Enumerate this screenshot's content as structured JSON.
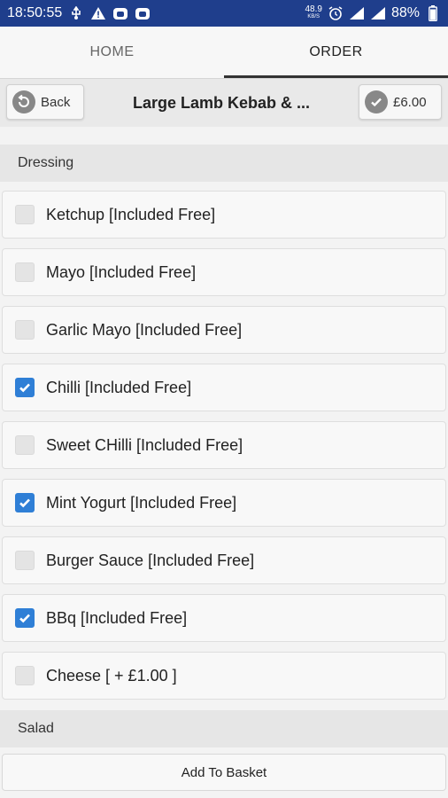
{
  "status_bar": {
    "time": "18:50:55",
    "net_speed_value": "48.9",
    "net_speed_unit": "KB/S",
    "battery": "88%",
    "left_icons": [
      "usb-icon",
      "warning-icon",
      "app-notification-icon",
      "app-notification-icon"
    ],
    "right_icons": [
      "alarm-icon",
      "signal-icon",
      "signal-icon",
      "battery-icon"
    ]
  },
  "tabs": [
    {
      "label": "HOME",
      "active": false
    },
    {
      "label": "ORDER",
      "active": true
    }
  ],
  "header": {
    "back_label": "Back",
    "title": "Large Lamb Kebab & ...",
    "price": "£6.00"
  },
  "sections": {
    "dressing": "Dressing",
    "salad": "Salad"
  },
  "options": [
    {
      "label": "Ketchup [Included Free]",
      "checked": false
    },
    {
      "label": "Mayo [Included Free]",
      "checked": false
    },
    {
      "label": "Garlic Mayo [Included Free]",
      "checked": false
    },
    {
      "label": "Chilli [Included Free]",
      "checked": true
    },
    {
      "label": "Sweet CHilli [Included Free]",
      "checked": false
    },
    {
      "label": "Mint Yogurt [Included Free]",
      "checked": true
    },
    {
      "label": "Burger Sauce [Included Free]",
      "checked": false
    },
    {
      "label": "BBq [Included Free]",
      "checked": true
    },
    {
      "label": "Cheese [ + £1.00 ]",
      "checked": false
    }
  ],
  "add_to_basket_label": "Add To Basket",
  "colors": {
    "status_bar": "#1f3e8c",
    "checkbox_checked": "#2f7fd6"
  }
}
